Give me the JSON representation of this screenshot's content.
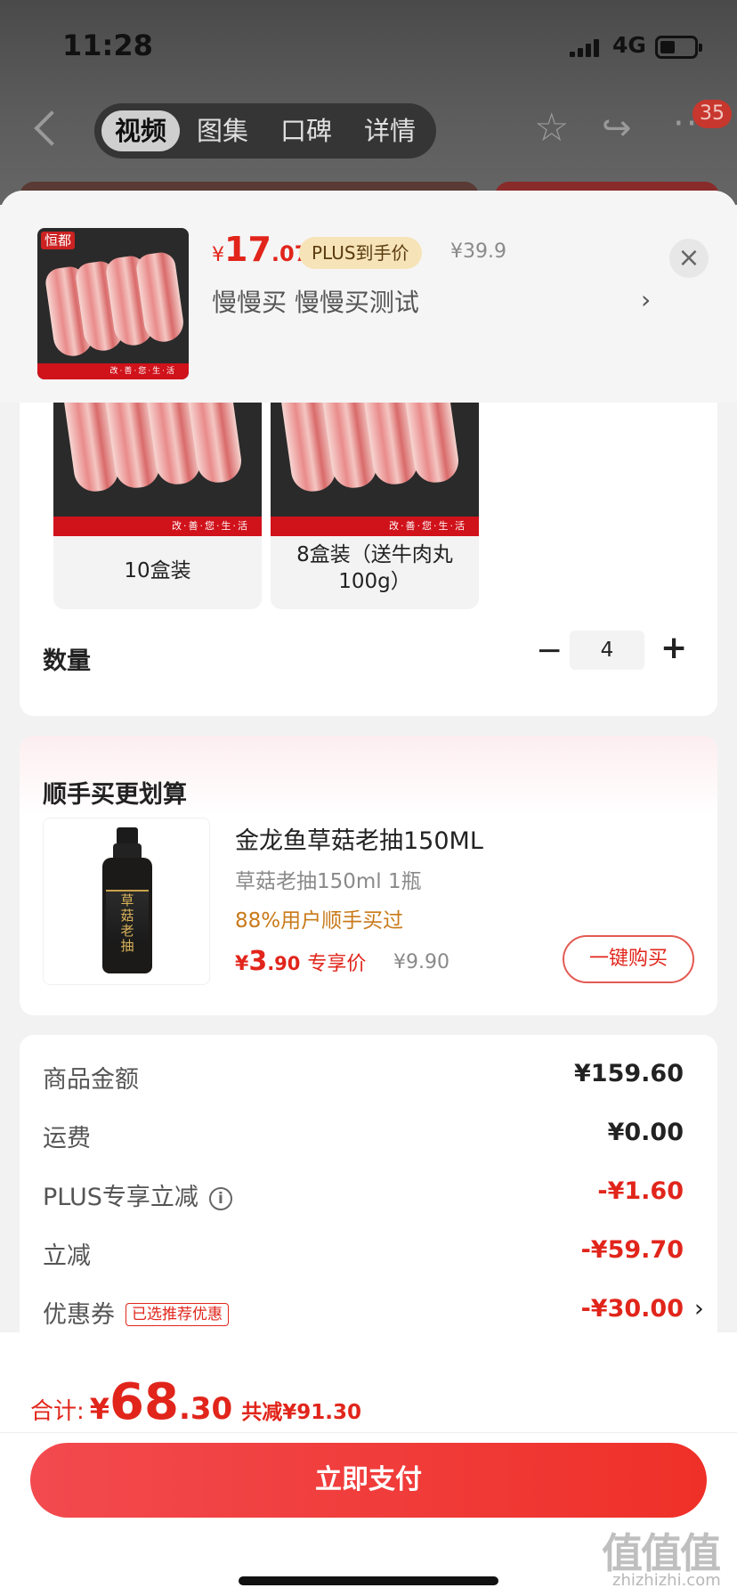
{
  "status_bar": {
    "time": "11:28",
    "network": "4G"
  },
  "nav": {
    "tabs": [
      "视频",
      "图集",
      "口碑",
      "详情"
    ],
    "active_tab": "视频",
    "cart_badge": "35"
  },
  "product": {
    "brand_tag": "恒都",
    "price_currency": "¥",
    "price_int": "17",
    "price_dec": ".07",
    "plus_tag": "PLUS到手价",
    "original_price": "¥39.9",
    "selected_spec": "慢慢买  慢慢买测试"
  },
  "options": [
    {
      "label": "10盒装",
      "strip": "改·善·您·生·活"
    },
    {
      "label": "8盒装（送牛肉丸100g）",
      "strip": "改·善·您·生·活"
    }
  ],
  "quantity": {
    "label": "数量",
    "value": "4",
    "minus": "−",
    "plus": "+"
  },
  "upsell": {
    "section_title": "顺手买更划算",
    "name": "金龙鱼草菇老抽150ML",
    "spec": "草菇老抽150ml 1瓶",
    "social_proof": "88%用户顺手买过",
    "price_currency": "¥",
    "price_int": "3",
    "price_dec": ".90",
    "price_tag": "专享价",
    "original_price": "¥9.90",
    "buy_button": "一键购买",
    "bottle_text": "草菇老抽"
  },
  "fees": [
    {
      "label": "商品金额",
      "value": "¥159.60",
      "red": false
    },
    {
      "label": "运费",
      "value": "¥0.00",
      "red": false
    },
    {
      "label": "PLUS专享立减",
      "value": "-¥1.60",
      "red": true,
      "info": "i"
    },
    {
      "label": "立减",
      "value": "-¥59.70",
      "red": true
    },
    {
      "label": "优惠券",
      "value": "-¥30.00",
      "red": true,
      "tag": "已选推荐优惠"
    }
  ],
  "footer": {
    "total_label": "合计:",
    "total_currency": "¥",
    "total_int": "68",
    "total_dec": ".30",
    "saved": "共减¥91.30",
    "pay_button": "立即支付"
  },
  "watermark": {
    "mark": "值值值",
    "domain": "zhizhizhi.com"
  },
  "colors": {
    "accent": "#e1251b",
    "plus_gold": "#f7e3b8",
    "social_orange": "#c97a1a"
  }
}
